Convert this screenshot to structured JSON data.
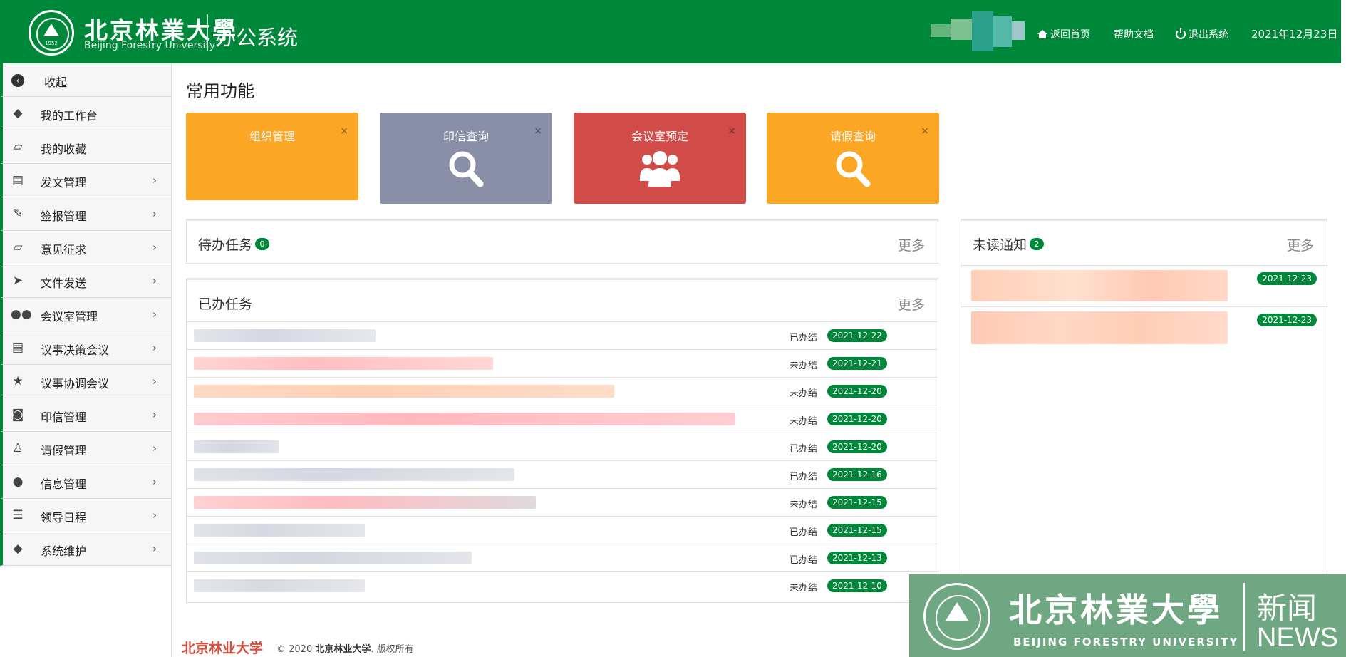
{
  "header": {
    "brand_cn": "北京林業大學",
    "brand_en": "Beijing Forestry University",
    "seal_year": "1952",
    "system_title": "办公系统",
    "links": [
      {
        "label": "返回首页",
        "icon": "home-icon"
      },
      {
        "label": "帮助文档",
        "icon": ""
      },
      {
        "label": "退出系统",
        "icon": "power-icon"
      }
    ],
    "date": "2021年12月23日"
  },
  "sidebar": {
    "items": [
      {
        "label": "收起",
        "icon": "collapse-icon",
        "chevron": false
      },
      {
        "label": "我的工作台",
        "icon": "tag-icon",
        "chevron": false
      },
      {
        "label": "我的收藏",
        "icon": "folder-open-icon",
        "chevron": false
      },
      {
        "label": "发文管理",
        "icon": "document-icon",
        "chevron": true
      },
      {
        "label": "签报管理",
        "icon": "edit-icon",
        "chevron": true
      },
      {
        "label": "意见征求",
        "icon": "folder-open-icon",
        "chevron": true
      },
      {
        "label": "文件发送",
        "icon": "send-icon",
        "chevron": true
      },
      {
        "label": "会议室管理",
        "icon": "users-icon",
        "chevron": true
      },
      {
        "label": "议事决策会议",
        "icon": "document-icon",
        "chevron": true
      },
      {
        "label": "议事协调会议",
        "icon": "star-icon",
        "chevron": true
      },
      {
        "label": "印信管理",
        "icon": "stop-circle-icon",
        "chevron": true
      },
      {
        "label": "请假管理",
        "icon": "user-icon",
        "chevron": true
      },
      {
        "label": "信息管理",
        "icon": "comments-icon",
        "chevron": true
      },
      {
        "label": "领导日程",
        "icon": "list-icon",
        "chevron": true
      },
      {
        "label": "系统维护",
        "icon": "tags-icon",
        "chevron": true
      }
    ]
  },
  "main": {
    "section_title": "常用功能",
    "tiles": [
      {
        "label": "组织管理",
        "color": "#fba625",
        "icon": "",
        "close": "×"
      },
      {
        "label": "印信查询",
        "color": "#8a8fa8",
        "icon": "search-icon",
        "close": "×"
      },
      {
        "label": "会议室预定",
        "color": "#d14c48",
        "icon": "users-icon",
        "close": "×"
      },
      {
        "label": "请假查询",
        "color": "#fba625",
        "icon": "search-icon",
        "close": "×"
      }
    ],
    "pending": {
      "title": "待办任务",
      "count": "0",
      "more": "更多"
    },
    "done": {
      "title": "已办任务",
      "more": "更多",
      "rows": [
        {
          "status": "已办结",
          "date": "2021-12-22"
        },
        {
          "status": "未办结",
          "date": "2021-12-21"
        },
        {
          "status": "未办结",
          "date": "2021-12-20"
        },
        {
          "status": "未办结",
          "date": "2021-12-20"
        },
        {
          "status": "已办结",
          "date": "2021-12-20"
        },
        {
          "status": "已办结",
          "date": "2021-12-16"
        },
        {
          "status": "未办结",
          "date": "2021-12-15"
        },
        {
          "status": "已办结",
          "date": "2021-12-15"
        },
        {
          "status": "已办结",
          "date": "2021-12-13"
        },
        {
          "status": "未办结",
          "date": "2021-12-10"
        }
      ]
    },
    "notices": {
      "title": "未读通知",
      "count": "2",
      "more": "更多",
      "rows": [
        {
          "date": "2021-12-23"
        },
        {
          "date": "2021-12-23"
        }
      ]
    }
  },
  "footer": {
    "brand": "北京林业大学",
    "copy_prefix": "© 2020 ",
    "copy_owner": "北京林业大学",
    "copy_suffix": ". 版权所有"
  },
  "watermark": {
    "brand_cn": "北京林業大學",
    "brand_en": "BEIJING FORESTRY UNIVERSITY",
    "news_cn": "新闻",
    "news_en": "NEWS",
    "seal_year": "1952"
  }
}
